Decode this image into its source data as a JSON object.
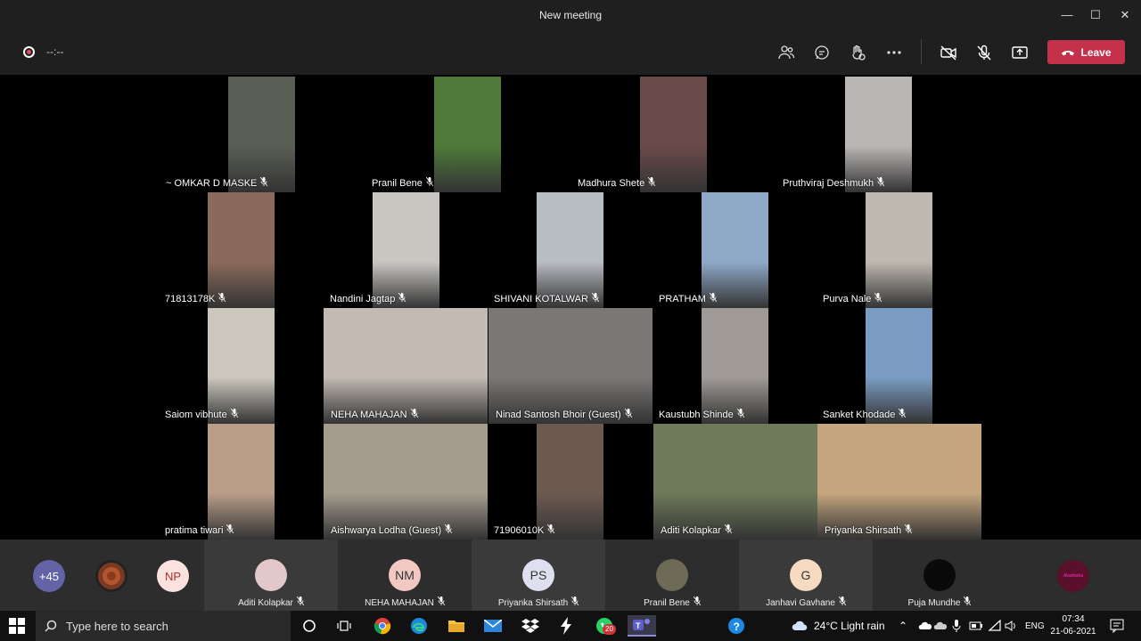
{
  "window": {
    "title": "New meeting"
  },
  "toolbar": {
    "timer": "--:--",
    "leave_label": "Leave"
  },
  "tiles": [
    {
      "name": "~ OMKAR D MASKE",
      "bg": "#5a5f55"
    },
    {
      "name": "Pranil Bene",
      "bg": "#4f7a3a"
    },
    {
      "name": "Madhura  Shete",
      "bg": "#6b4a4a"
    },
    {
      "name": "Pruthviraj Deshmukh",
      "bg": "#b9b6b4"
    },
    {
      "name": "71813178K",
      "bg": "#8a6a5a"
    },
    {
      "name": "Nandini Jagtap",
      "bg": "#c9c6c2"
    },
    {
      "name": "SHIVANI KOTALWAR",
      "bg": "#b8bcc3"
    },
    {
      "name": "PRATHAM",
      "bg": "#8fa9c9"
    },
    {
      "name": "Purva Nale",
      "bg": "#bfb8b0"
    },
    {
      "name": "Saiom vibhute",
      "bg": "#cbc7bd"
    },
    {
      "name": "NEHA MAHAJAN",
      "bg": "#c2bab3"
    },
    {
      "name": "Ninad Santosh Bhoir (Guest)",
      "bg": "#7a7775"
    },
    {
      "name": "Kaustubh Shinde",
      "bg": "#9f9a95"
    },
    {
      "name": "Sanket Khodade",
      "bg": "#7a9cc2"
    },
    {
      "name": "pratima tiwari",
      "bg": "#b99d88"
    },
    {
      "name": "Aishwarya Lodha (Guest)",
      "bg": "#a59c8e"
    },
    {
      "name": "71906010K",
      "bg": "#6c5a50"
    },
    {
      "name": "Aditi Kolapkar",
      "bg": "#6e7a5a"
    },
    {
      "name": "Priyanka Shirsath",
      "bg": "#c4a57e"
    }
  ],
  "roster": {
    "overflow_count": "+45",
    "initials_np": "NP",
    "people": [
      {
        "name": "Aditi Kolapkar",
        "initials": "",
        "bg": "#e2c8c9"
      },
      {
        "name": "NEHA MAHAJAN",
        "initials": "NM",
        "bg": "#f2c9c2"
      },
      {
        "name": "Priyanka Shirsath",
        "initials": "PS",
        "bg": "#dfe0ef"
      },
      {
        "name": "Pranil Bene",
        "initials": "",
        "bg": "#6d6a55"
      },
      {
        "name": "Janhavi Gavhane",
        "initials": "G",
        "bg": "#f6dbc0"
      },
      {
        "name": "Puja Mundhe",
        "initials": "",
        "bg": "#0a0a0a"
      }
    ],
    "last_avatar_text": "Akanksha"
  },
  "taskbar": {
    "search_placeholder": "Type here to search",
    "weather": "24°C  Light rain",
    "lang": "ENG",
    "time": "07:34",
    "date": "21-06-2021",
    "whatsapp_badge": "20"
  }
}
